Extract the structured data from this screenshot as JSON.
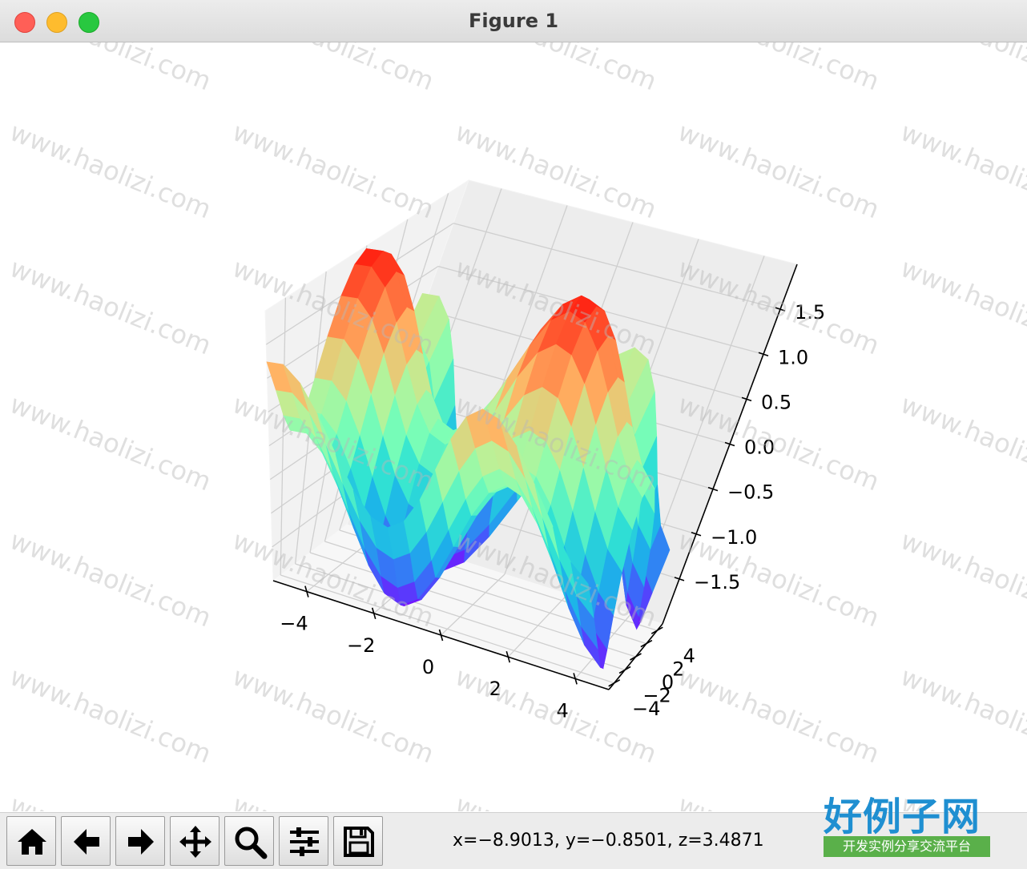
{
  "window": {
    "title": "Figure 1"
  },
  "watermark": {
    "text": "www.haolizi.com"
  },
  "logo": {
    "main": "好例子网",
    "sub": "开发实例分享交流平台"
  },
  "toolbar": {
    "buttons": [
      {
        "name": "home-button",
        "icon": "home-icon"
      },
      {
        "name": "back-button",
        "icon": "arrow-left-icon"
      },
      {
        "name": "forward-button",
        "icon": "arrow-right-icon"
      },
      {
        "name": "pan-button",
        "icon": "move-icon"
      },
      {
        "name": "zoom-button",
        "icon": "magnifier-icon"
      },
      {
        "name": "configure-subplots-button",
        "icon": "sliders-icon"
      },
      {
        "name": "save-button",
        "icon": "floppy-disk-icon"
      }
    ],
    "coords": "x=−8.9013, y=−0.8501, z=3.4871"
  },
  "chart_data": {
    "type": "surface",
    "colormap": "rainbow",
    "title": "",
    "xlabel": "",
    "ylabel": "",
    "zlabel": "",
    "x_ticks": [
      "−4",
      "−2",
      "0",
      "2",
      "4"
    ],
    "y_ticks": [
      "−4",
      "−2",
      "0",
      "2",
      "4"
    ],
    "z_ticks": [
      "−1.5",
      "−1.0",
      "−0.5",
      "0.0",
      "0.5",
      "1.0",
      "1.5"
    ],
    "xlim": [
      -5,
      5
    ],
    "ylim": [
      -5,
      5
    ],
    "zlim": [
      -2,
      2
    ],
    "grid": true,
    "x": [
      -5,
      -4.5,
      -4,
      -3.5,
      -3,
      -2.5,
      -2,
      -1.5,
      -1,
      -0.5,
      0,
      0.5,
      1,
      1.5,
      2,
      2.5,
      3,
      3.5,
      4,
      4.5
    ],
    "y": [
      -5,
      -4.5,
      -4,
      -3.5,
      -3,
      -2.5,
      -2,
      -1.5,
      -1,
      -0.5,
      0,
      0.5,
      1,
      1.5,
      2,
      2.5,
      3,
      3.5,
      4,
      4.5
    ],
    "z_note": "z = sin(x) + cos(y)"
  }
}
